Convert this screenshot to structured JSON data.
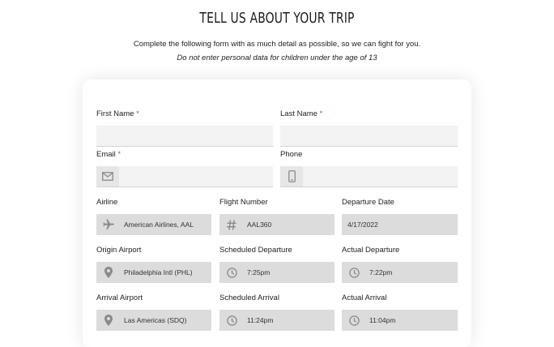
{
  "header": {
    "title": "TELL US ABOUT YOUR TRIP",
    "subtitle": "Complete the following form with as much detail as possible, so we can fight for you.",
    "note": "Do not enter personal data for children under the age of 13"
  },
  "form": {
    "required_marker": "*",
    "first_name": {
      "label": "First Name",
      "value": ""
    },
    "last_name": {
      "label": "Last Name",
      "value": ""
    },
    "email": {
      "label": "Email",
      "value": "",
      "icon": "envelope-icon"
    },
    "phone": {
      "label": "Phone",
      "value": "",
      "icon": "mobile-phone-icon"
    },
    "airline": {
      "label": "Airline",
      "value": "American Airlines, AAL",
      "icon": "airplane-icon"
    },
    "flight_number": {
      "label": "Flight Number",
      "value": "AAL360",
      "icon": "hash-icon"
    },
    "departure_date": {
      "label": "Departure Date",
      "value": "4/17/2022"
    },
    "origin_airport": {
      "label": "Origin Airport",
      "value": "Philadelphia Intl (PHL)",
      "icon": "map-pin-icon"
    },
    "scheduled_departure": {
      "label": "Scheduled Departure",
      "value": "7:25pm",
      "icon": "clock-icon"
    },
    "actual_departure": {
      "label": "Actual Departure",
      "value": "7:22pm",
      "icon": "clock-icon"
    },
    "arrival_airport": {
      "label": "Arrival Airport",
      "value": "Las Americas (SDQ)",
      "icon": "map-pin-icon"
    },
    "scheduled_arrival": {
      "label": "Scheduled Arrival",
      "value": "11:24pm",
      "icon": "clock-icon"
    },
    "actual_arrival": {
      "label": "Actual Arrival",
      "value": "11:04pm",
      "icon": "clock-icon"
    }
  },
  "colors": {
    "required": "#3a7bd5",
    "input_bg": "#f3f3f3",
    "readonly_bg": "#dcdcdc",
    "icon": "#8a8a8a"
  }
}
